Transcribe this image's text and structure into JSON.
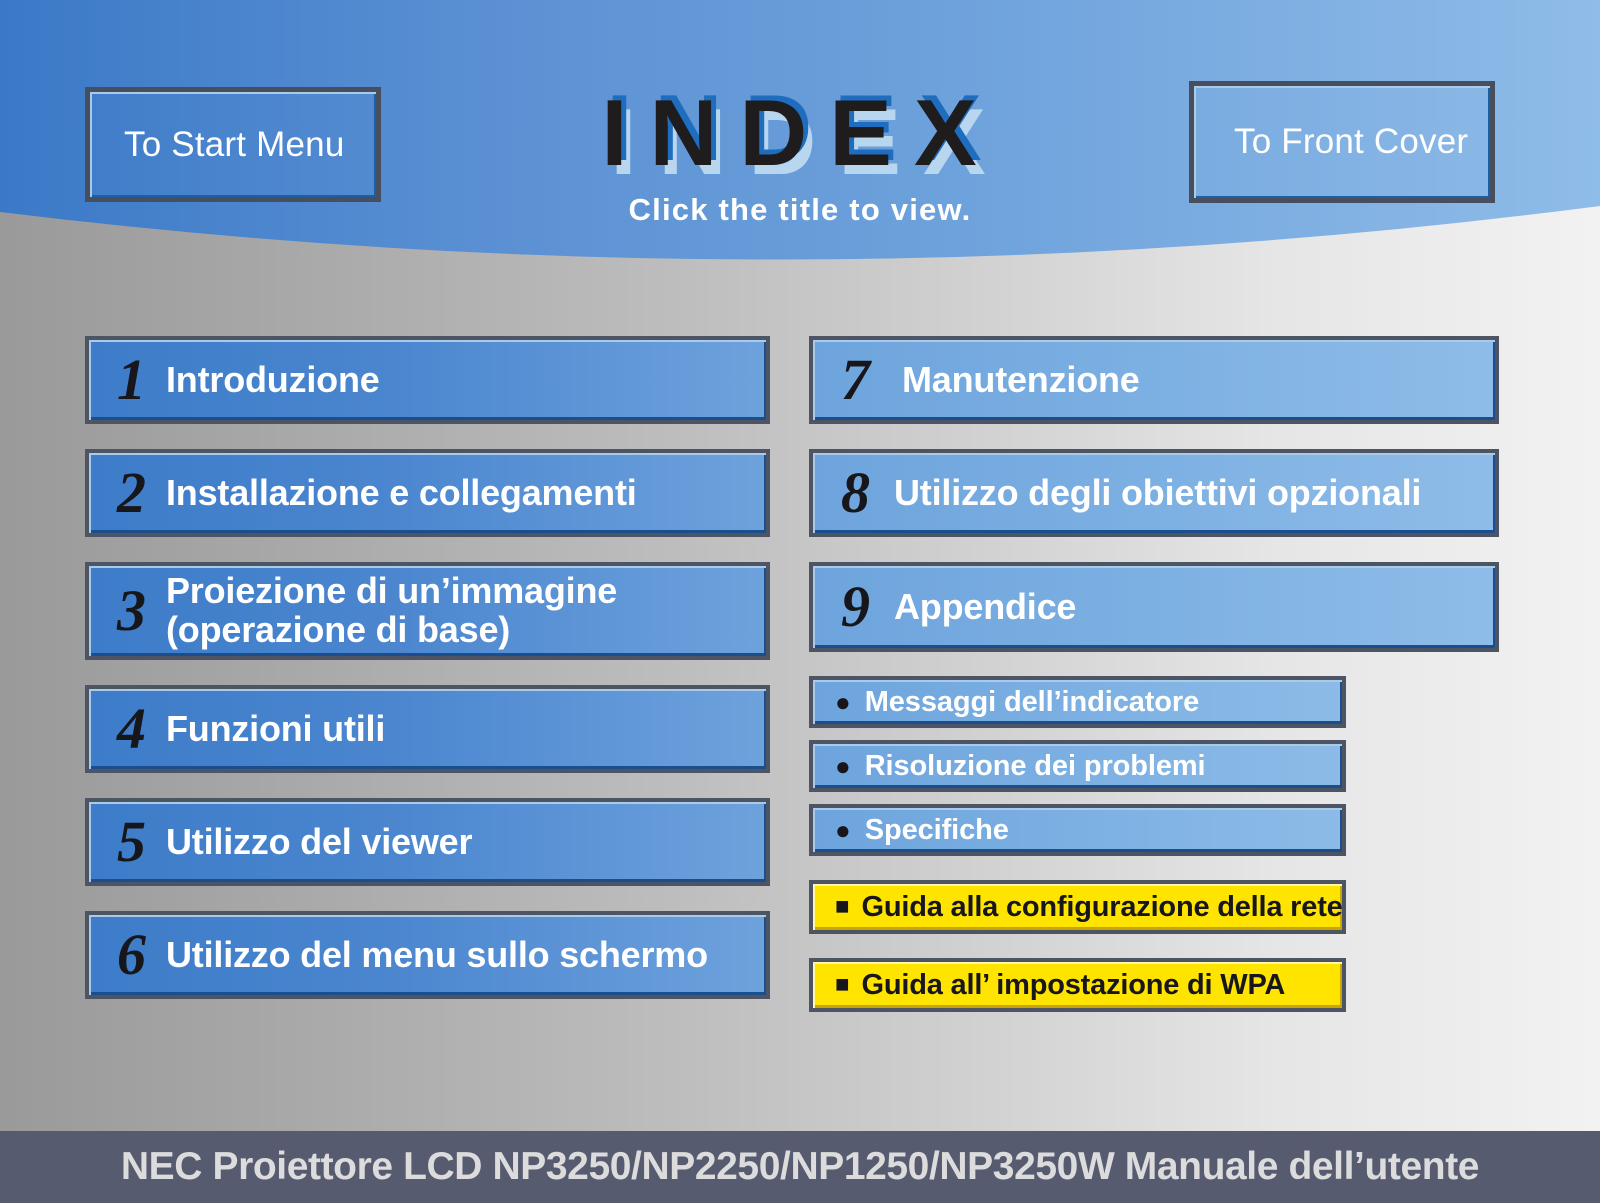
{
  "header": {
    "start_button_label": "To Start Menu",
    "front_cover_button_label": "To Front Cover",
    "title": "INDEX",
    "subtitle": "Click the title to view.",
    "band_color_left": "#3d7cc9",
    "band_color_right": "#8fbce8"
  },
  "chapters_left": [
    {
      "number": "1",
      "title": "Introduzione"
    },
    {
      "number": "2",
      "title": "Installazione e collegamenti"
    },
    {
      "number": "3",
      "title": "Proiezione di un’immagine\n(operazione di base)"
    },
    {
      "number": "4",
      "title": "Funzioni utili"
    },
    {
      "number": "5",
      "title": "Utilizzo del viewer"
    },
    {
      "number": "6",
      "title": "Utilizzo del menu sullo schermo"
    }
  ],
  "chapters_right": [
    {
      "number": "7",
      "title": "Manutenzione"
    },
    {
      "number": "8",
      "title": "Utilizzo degli obiettivi opzionali"
    },
    {
      "number": "9",
      "title": "Appendice"
    }
  ],
  "sub_items": [
    {
      "marker": "●",
      "label": "Messaggi dell’indicatore"
    },
    {
      "marker": "●",
      "label": "Risoluzione dei problemi"
    },
    {
      "marker": "●",
      "label": "Specifiche"
    }
  ],
  "guide_items": [
    {
      "marker": "■",
      "label": "Guida alla configurazione della rete"
    },
    {
      "marker": "■",
      "label": "Guida all’ impostazione di WPA"
    }
  ],
  "footer": {
    "text": "NEC Proiettore LCD NP3250/NP2250/NP1250/NP3250W Manuale dell’utente",
    "background": "#565b70",
    "text_color": "#dcdcdc"
  }
}
